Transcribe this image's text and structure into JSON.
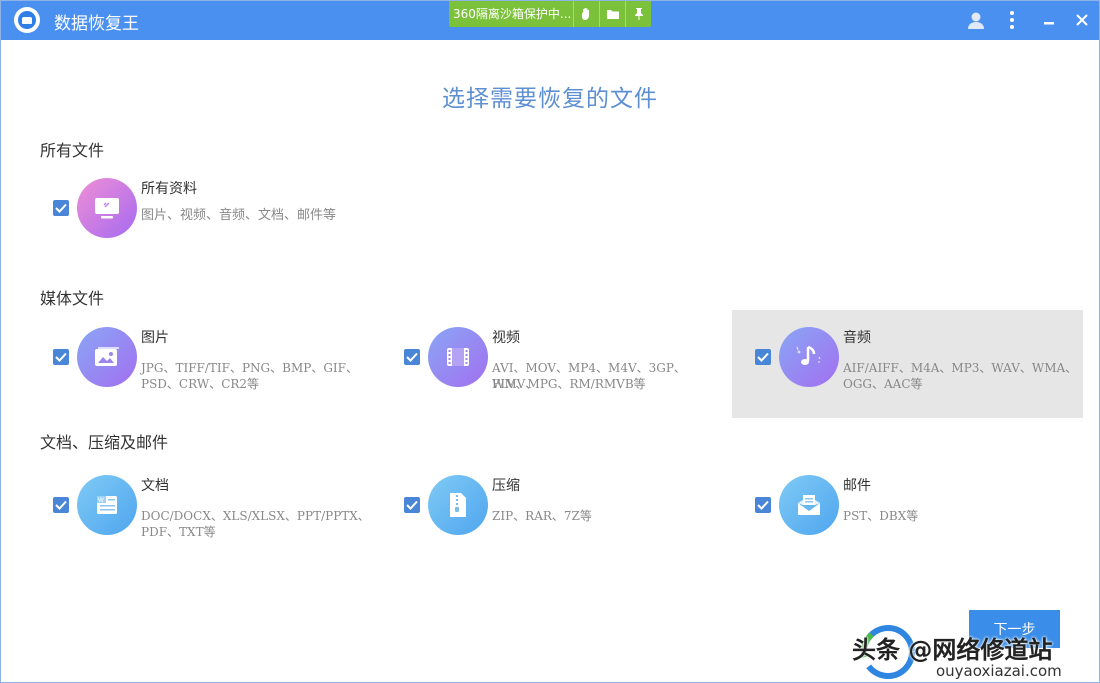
{
  "app": {
    "title": "数据恢复王"
  },
  "sandbox": {
    "text": "360隔离沙箱保护中..."
  },
  "page_title": "选择需要恢复的文件",
  "sections": [
    {
      "title": "所有文件"
    },
    {
      "title": "媒体文件"
    },
    {
      "title": "文档、压缩及邮件"
    }
  ],
  "items": {
    "all": {
      "name": "所有资料",
      "desc": "图片、视频、音频、文档、邮件等",
      "checked": true,
      "icon": "monitor-icon"
    },
    "pictures": {
      "name": "图片",
      "desc_line1": "JPG、TIFF/TIF、PNG、BMP、GIF、",
      "desc_line2": "PSD、CRW、CR2等",
      "checked": true,
      "icon": "picture-icon"
    },
    "video": {
      "name": "视频",
      "desc_line1": "AVI、MOV、MP4、M4V、3GP、WMV、",
      "desc_line2": "FLV、MPG、RM/RMVB等",
      "checked": true,
      "icon": "film-icon"
    },
    "audio": {
      "name": "音频",
      "desc_line1": "AIF/AIFF、M4A、MP3、WAV、WMA、",
      "desc_line2": "OGG、AAC等",
      "checked": true,
      "icon": "music-note-icon"
    },
    "docs": {
      "name": "文档",
      "desc_line1": "DOC/DOCX、XLS/XLSX、PPT/PPTX、",
      "desc_line2": "PDF、TXT等",
      "checked": true,
      "icon": "document-icon"
    },
    "archive": {
      "name": "压缩",
      "desc": "ZIP、RAR、7Z等",
      "checked": true,
      "icon": "zip-icon"
    },
    "mail": {
      "name": "邮件",
      "desc": "PST、DBX等",
      "checked": true,
      "icon": "mail-icon"
    }
  },
  "next_button": {
    "label": "下一步"
  },
  "watermark": {
    "text": "头条 @网络修道站",
    "url": "ouyaoxiazai.com"
  },
  "colors": {
    "titlebar": "#4a90f0",
    "sandbox": "#7cc13a",
    "accent": "#3a8de8",
    "selected_bg": "#e6e6e6"
  }
}
